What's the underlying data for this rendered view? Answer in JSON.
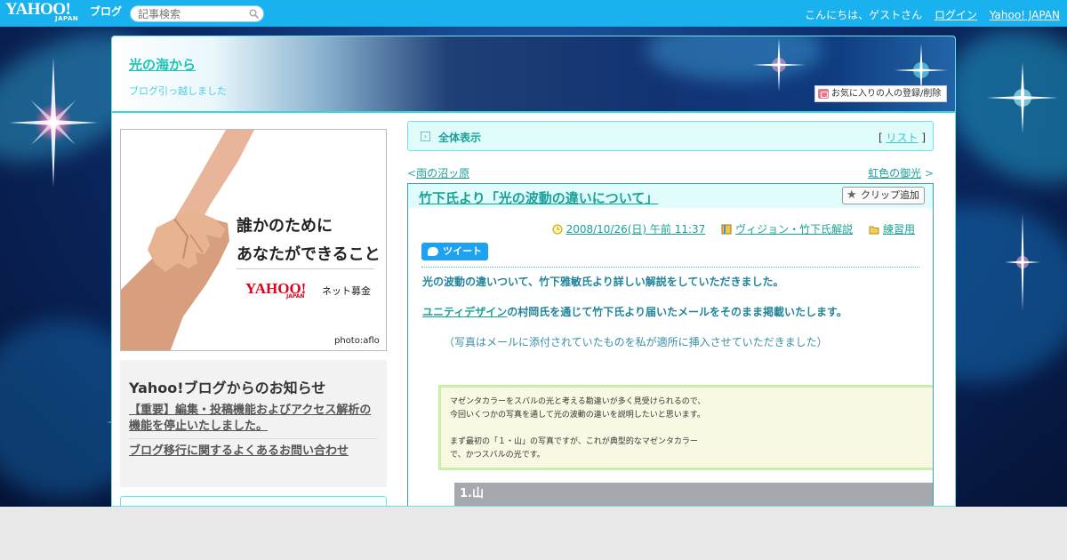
{
  "header": {
    "logo": "YAHOO!",
    "logo_sub": "JAPAN",
    "logo_blog": "ブログ",
    "search_placeholder": "記事検索",
    "greeting": "こんにちは、ゲストさん",
    "login": "ログイン",
    "yahoo_japan": "Yahoo! JAPAN"
  },
  "blog": {
    "title": "光の海から",
    "description": "ブログ引っ越しました",
    "favorite_button": "お気に入りの人の登録/削除"
  },
  "sidebar": {
    "ad": {
      "line1": "誰かのために",
      "line2": "あなたができること",
      "brand": "YAHOO!",
      "brand_sub": "JAPAN",
      "service": "ネット募金",
      "credit": "photo:aflo"
    },
    "notice": {
      "title": "Yahoo!ブログからのお知らせ",
      "items": [
        "【重要】編集・投稿機能およびアクセス解析の機能を停止いたしました。",
        "ブログ移行に関するよくあるお問い合わせ"
      ]
    }
  },
  "main": {
    "all_view": "全体表示",
    "list_bracket_open": "[",
    "list_label": "リスト",
    "list_bracket_close": "]",
    "prev_marker": "<",
    "prev": "雨の沼ッ原",
    "next": "虹色の御光",
    "next_marker": ">",
    "article": {
      "title": "竹下氏より「光の波動の違いについて」",
      "clip_button": "クリップ追加",
      "date": "2008/10/26(日) 午前 11:37",
      "category1": "ヴィジョン・竹下氏解説",
      "category2": "練習用",
      "tweet": "ツイート",
      "para1": "光の波動の違いついて、竹下雅敏氏より詳しい解説をしていただきました。",
      "para2_link": "ユニティデザイン",
      "para2_rest": "の村岡氏を通じて竹下氏より届いたメールをそのまま掲載いたします。",
      "para3": "（写真はメールに添付されていたものを私が適所に挿入させていただきました）",
      "quote_lines": [
        "マゼンタカラーをスバルの光と考える勘違いが多く見受けられるので、",
        "今回いくつかの写真を通して光の波動の違いを説明したいと思います。",
        "",
        "まず最初の「１・山」の写真ですが、これが典型的なマゼンタカラー",
        "で、かつスバルの光です。"
      ],
      "photo_heading": "1.山"
    }
  },
  "colors": {
    "topbar": "#1ab2ee",
    "accent": "#1aa199",
    "frame_border": "#6fe0ea"
  }
}
